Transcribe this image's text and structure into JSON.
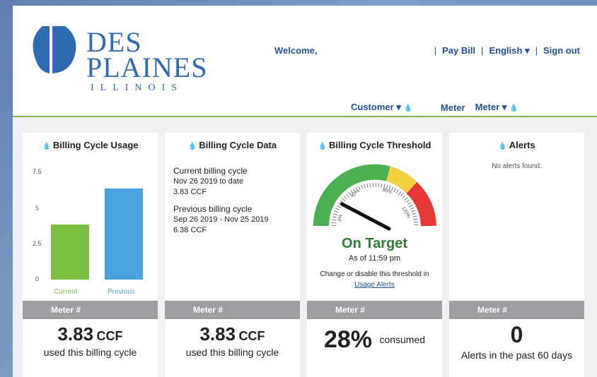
{
  "header": {
    "logo_line1": "DES",
    "logo_line2": "PLAINES",
    "logo_line3": "ILLINOIS",
    "welcome": "Welcome,",
    "pay_bill": "Pay Bill",
    "language": "English",
    "sign_out": "Sign out",
    "sep": "|"
  },
  "subnav": {
    "customer": "Customer",
    "meter_label": "Meter",
    "meter_dropdown": "Meter"
  },
  "usage_card": {
    "title": "Billing Cycle Usage",
    "meter_label": "Meter #",
    "value": "3.83",
    "unit": "CCF",
    "sub": "used this billing cycle"
  },
  "chart_data": {
    "type": "bar",
    "categories": [
      "Current",
      "Previous"
    ],
    "values": [
      3.83,
      6.38
    ],
    "colors": [
      "#7bc043",
      "#4aa3df"
    ],
    "yticks": [
      "7.5",
      "5",
      "2.5",
      "0"
    ],
    "ylim": [
      0,
      7.5
    ]
  },
  "data_card": {
    "title": "Billing Cycle Data",
    "current_head": "Current billing cycle",
    "current_range": "Nov 26 2019 to date",
    "current_val": "3.83 CCF",
    "prev_head": "Previous billing cycle",
    "prev_range": "Sep 26 2019 - Nov 25 2019",
    "prev_val": "6.38 CCF",
    "meter_label": "Meter #",
    "value": "3.83",
    "unit": "CCF",
    "sub": "used this billing cycle"
  },
  "threshold_card": {
    "title": "Billing Cycle Threshold",
    "status": "On Target",
    "as_of": "As of 11:59 pm",
    "change_text": "Change or disable this threshold in",
    "link": "Usage Alerts",
    "gauge_labels": [
      "0%",
      "40%",
      "80%",
      "120%"
    ],
    "percent": 28,
    "meter_label": "Meter #",
    "value": "28%",
    "sub": "consumed"
  },
  "alerts_card": {
    "title": "Alerts",
    "empty": "No alerts found.",
    "meter_label": "Meter #",
    "value": "0",
    "sub": "Alerts in the past 60 days"
  },
  "colors": {
    "brand_blue": "#2e6bb3",
    "nav_blue": "#1d4f9c",
    "green": "#7bc043",
    "blue_bar": "#4aa3df",
    "gauge_green": "#4caf50",
    "gauge_yellow": "#f4d03f",
    "gauge_red": "#e53935"
  }
}
